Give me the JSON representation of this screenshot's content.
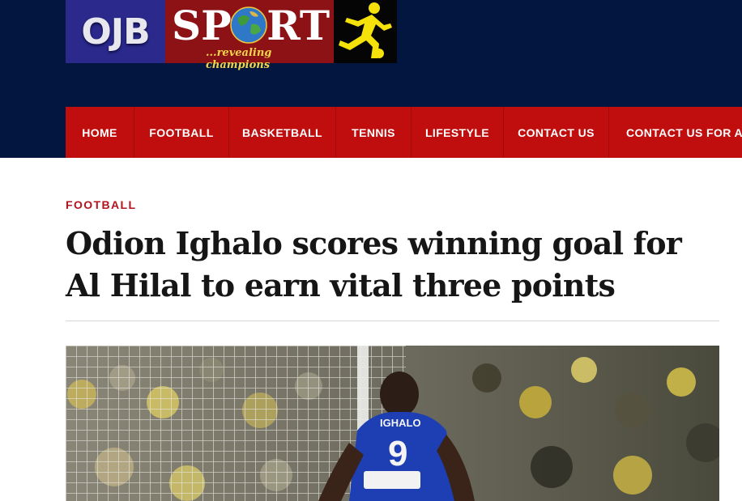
{
  "logo": {
    "ojb_text": "OJB",
    "sport_text": "SPORT",
    "tagline": "...revealing champions"
  },
  "nav": {
    "items": [
      {
        "label": "HOME"
      },
      {
        "label": "FOOTBALL"
      },
      {
        "label": "BASKETBALL"
      },
      {
        "label": "TENNIS"
      },
      {
        "label": "LIFESTYLE"
      },
      {
        "label": "CONTACT US"
      },
      {
        "label": "CONTACT US FOR AD"
      }
    ]
  },
  "article": {
    "category": "FOOTBALL",
    "title": "Odion Ighalo scores winning goal for Al Hilal to earn vital three points"
  },
  "photo": {
    "jersey_name": "IGHALO",
    "jersey_number": "9"
  },
  "colors": {
    "header_bg": "#03163f",
    "nav_bg": "#c00e0f",
    "category": "#b3141c"
  }
}
